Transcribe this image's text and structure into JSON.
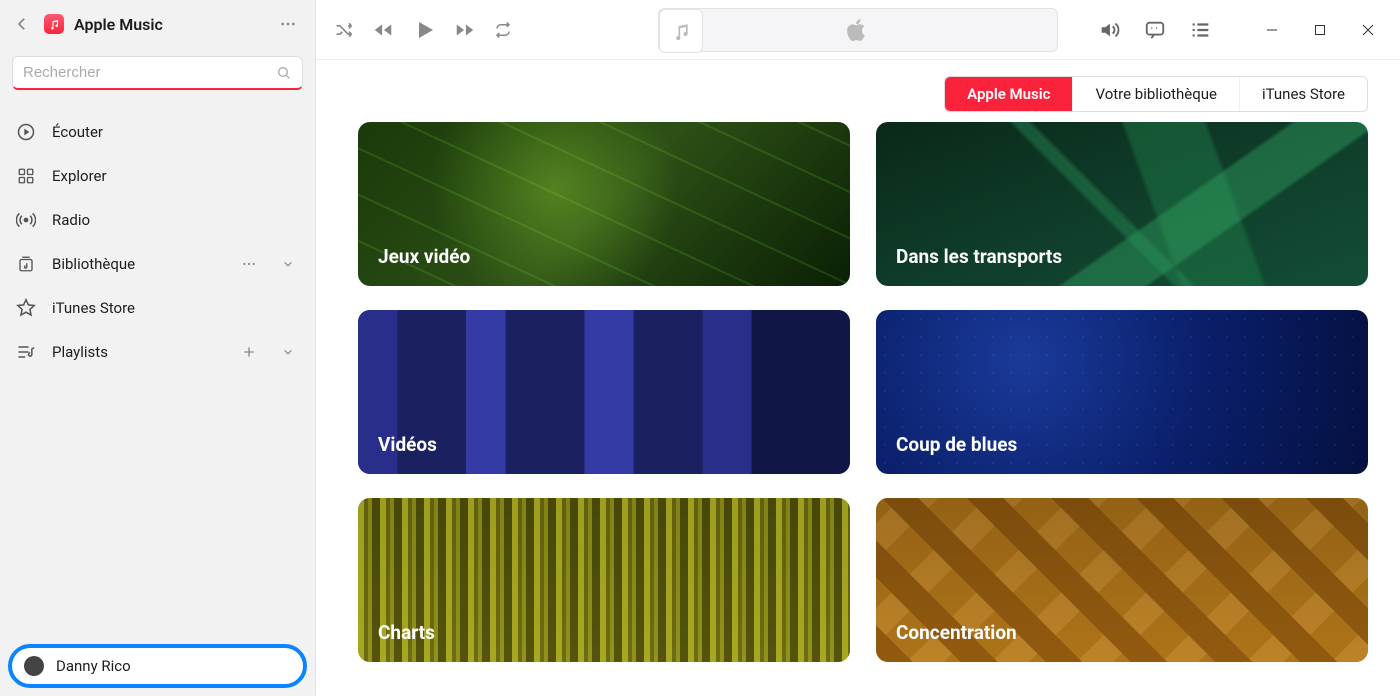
{
  "app": {
    "title": "Apple Music"
  },
  "search": {
    "placeholder": "Rechercher"
  },
  "sidebar": {
    "items": [
      {
        "label": "Écouter"
      },
      {
        "label": "Explorer"
      },
      {
        "label": "Radio"
      },
      {
        "label": "Bibliothèque"
      },
      {
        "label": "iTunes Store"
      },
      {
        "label": "Playlists"
      }
    ]
  },
  "user": {
    "name": "Danny Rico"
  },
  "tabs": {
    "items": [
      {
        "label": "Apple Music",
        "active": true
      },
      {
        "label": "Votre bibliothèque"
      },
      {
        "label": "iTunes Store"
      }
    ]
  },
  "cards": [
    {
      "label": "Jeux vidéo"
    },
    {
      "label": "Dans les transports"
    },
    {
      "label": "Vidéos"
    },
    {
      "label": "Coup de blues"
    },
    {
      "label": "Charts"
    },
    {
      "label": "Concentration"
    }
  ]
}
